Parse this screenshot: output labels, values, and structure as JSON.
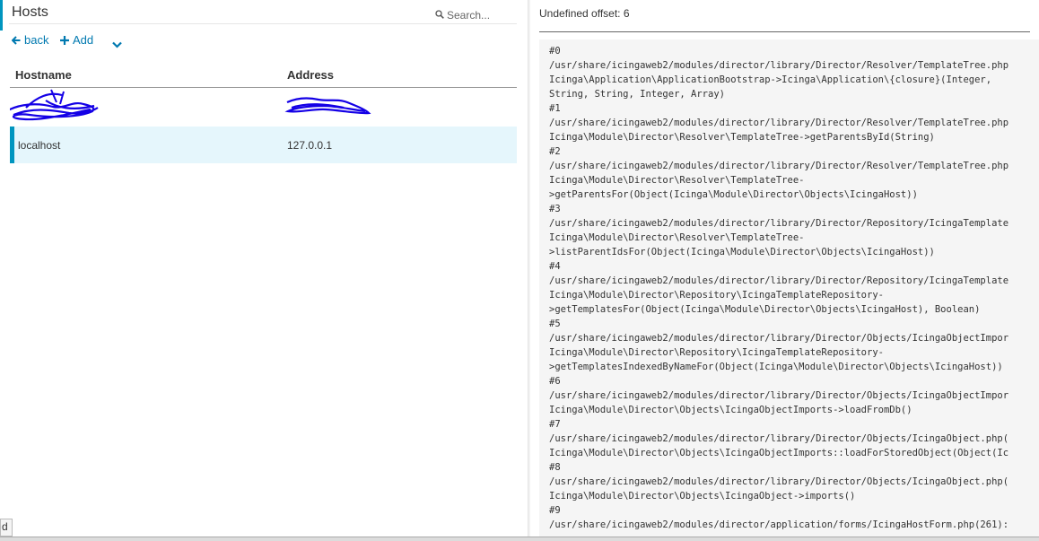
{
  "left": {
    "title": "Hosts",
    "search_placeholder": "Search...",
    "actions": {
      "back": "back",
      "add": "Add"
    },
    "columns": [
      "Hostname",
      "Address"
    ],
    "rows": [
      {
        "hostname": "",
        "address": "",
        "redacted": true
      },
      {
        "hostname": "localhost",
        "address": "127.0.0.1",
        "selected": true
      }
    ]
  },
  "right": {
    "error_title": "Undefined offset: 6",
    "trace": [
      "#0",
      "/usr/share/icingaweb2/modules/director/library/Director/Resolver/TemplateTree.php",
      "Icinga\\Application\\ApplicationBootstrap->Icinga\\Application\\{closure}(Integer,",
      "String, String, Integer, Array)",
      "#1",
      "/usr/share/icingaweb2/modules/director/library/Director/Resolver/TemplateTree.php",
      "Icinga\\Module\\Director\\Resolver\\TemplateTree->getParentsById(String)",
      "#2",
      "/usr/share/icingaweb2/modules/director/library/Director/Resolver/TemplateTree.php",
      "Icinga\\Module\\Director\\Resolver\\TemplateTree-",
      ">getParentsFor(Object(Icinga\\Module\\Director\\Objects\\IcingaHost))",
      "#3",
      "/usr/share/icingaweb2/modules/director/library/Director/Repository/IcingaTemplate",
      "Icinga\\Module\\Director\\Resolver\\TemplateTree-",
      ">listParentIdsFor(Object(Icinga\\Module\\Director\\Objects\\IcingaHost))",
      "#4",
      "/usr/share/icingaweb2/modules/director/library/Director/Repository/IcingaTemplate",
      "Icinga\\Module\\Director\\Repository\\IcingaTemplateRepository-",
      ">getTemplatesFor(Object(Icinga\\Module\\Director\\Objects\\IcingaHost), Boolean)",
      "#5",
      "/usr/share/icingaweb2/modules/director/library/Director/Objects/IcingaObjectImpor",
      "Icinga\\Module\\Director\\Repository\\IcingaTemplateRepository-",
      ">getTemplatesIndexedByNameFor(Object(Icinga\\Module\\Director\\Objects\\IcingaHost))",
      "#6",
      "/usr/share/icingaweb2/modules/director/library/Director/Objects/IcingaObjectImpor",
      "Icinga\\Module\\Director\\Objects\\IcingaObjectImports->loadFromDb()",
      "#7",
      "/usr/share/icingaweb2/modules/director/library/Director/Objects/IcingaObject.php(",
      "Icinga\\Module\\Director\\Objects\\IcingaObjectImports::loadForStoredObject(Object(Ic",
      "#8",
      "/usr/share/icingaweb2/modules/director/library/Director/Objects/IcingaObject.php(",
      "Icinga\\Module\\Director\\Objects\\IcingaObject->imports()",
      "#9",
      "/usr/share/icingaweb2/modules/director/application/forms/IcingaHostForm.php(261):"
    ]
  },
  "corner_text": "d",
  "colors": {
    "accent": "#0095bf",
    "link": "#0079b0",
    "selected_row": "#e5f6fc",
    "trace_bg": "#f5f5f5"
  },
  "icons": {
    "search": "magnifier-icon",
    "back": "arrow-left-icon",
    "add": "plus-icon",
    "more": "chevron-down-icon"
  }
}
